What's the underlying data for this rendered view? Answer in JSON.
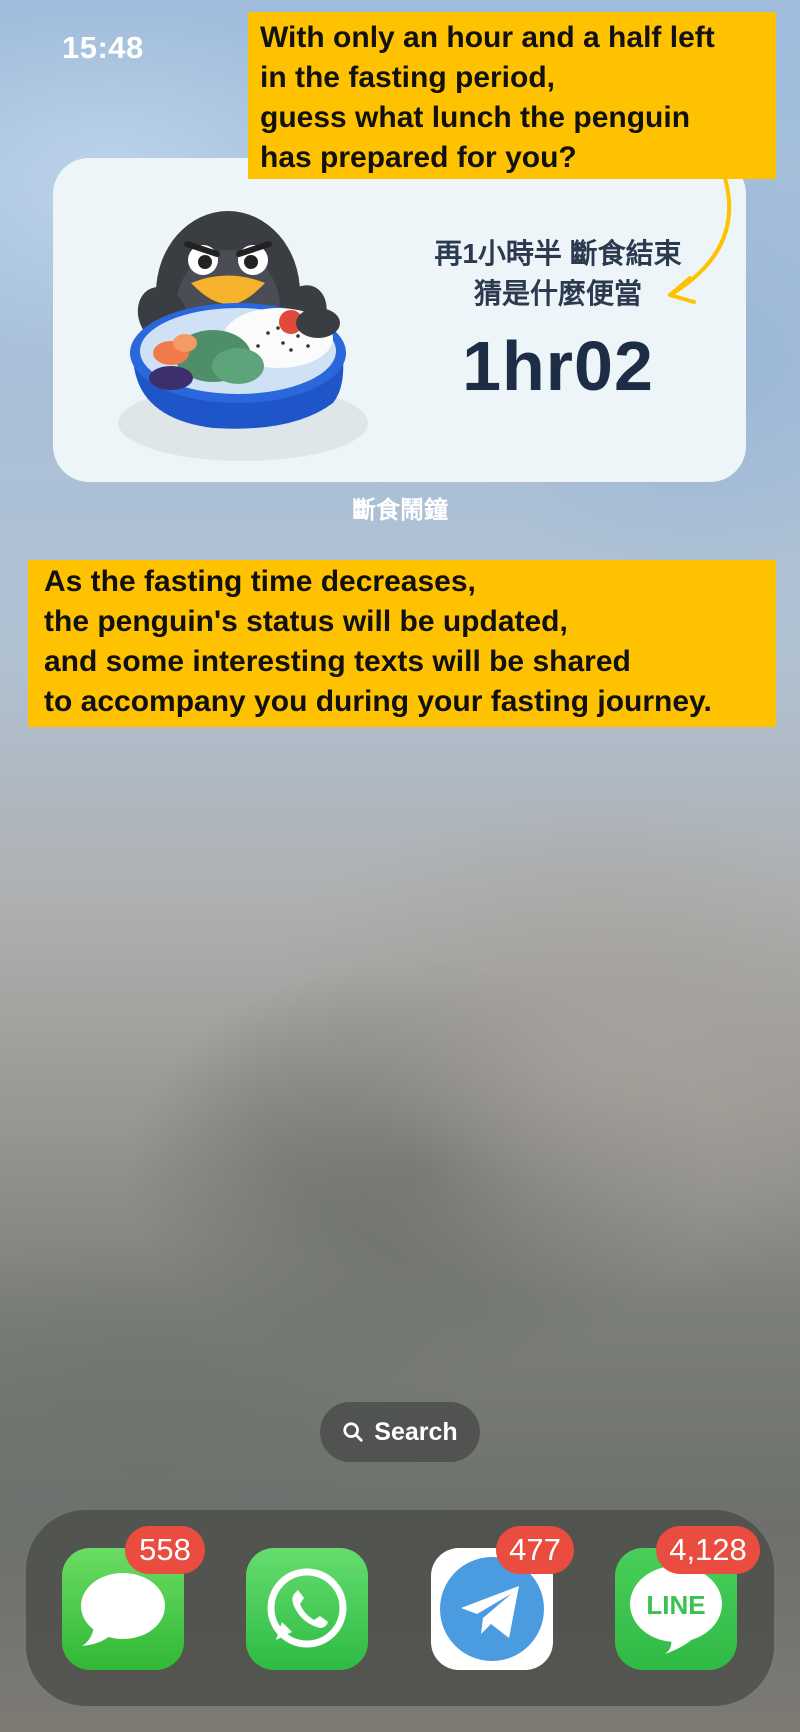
{
  "status_bar": {
    "time": "15:48"
  },
  "annotations": {
    "top_note_lines": [
      "With only an hour and a half left",
      "in the fasting period,",
      "guess what lunch the penguin",
      "has prepared for you?"
    ],
    "middle_note_lines": [
      "As the fasting time decreases,",
      "the penguin's status will be updated,",
      "and some interesting texts will be shared",
      "to accompany you during your fasting journey."
    ]
  },
  "widget": {
    "line1": "再1小時半 斷食結束",
    "line2": "猜是什麼便當",
    "timer": "1hr02",
    "app_label": "斷食鬧鐘",
    "illustration": "penguin-with-bento-box"
  },
  "search": {
    "label": "Search",
    "icon": "search-icon"
  },
  "dock": {
    "apps": [
      {
        "name": "Messages",
        "icon": "messages-icon",
        "badge": "558"
      },
      {
        "name": "WhatsApp",
        "icon": "whatsapp-icon",
        "badge": ""
      },
      {
        "name": "Telegram",
        "icon": "telegram-icon",
        "badge": "477"
      },
      {
        "name": "LINE",
        "icon": "line-icon",
        "badge": "4,128",
        "logo_text": "LINE"
      }
    ]
  },
  "colors": {
    "note_background": "#ffc200",
    "badge": "#ea4c3f",
    "widget_background": "#eef5f8",
    "timer_text": "#1d2d45"
  }
}
